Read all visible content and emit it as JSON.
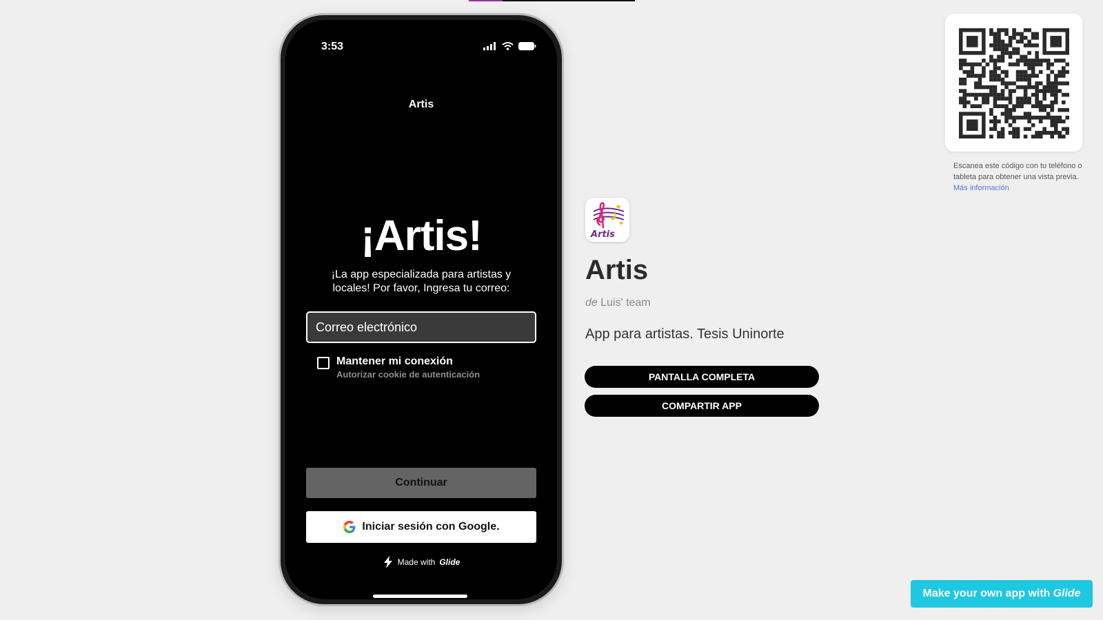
{
  "phone": {
    "status_time": "3:53",
    "app_title": "Artis",
    "hero": "¡Artis!",
    "subtitle": "¡La app especializada para artistas y locales! Por favor, Ingresa tu correo:",
    "email_placeholder": "Correo electrónico",
    "remember_label": "Mantener mi conexión",
    "remember_sub": "Autorizar cookie de autenticación",
    "continue_label": "Continuar",
    "google_label": "Iniciar sesión con Google.",
    "made_with_prefix": "Made with",
    "made_with_brand": "Glide"
  },
  "info": {
    "app_name": "Artis",
    "icon_text": "Artis",
    "by_prefix": "de",
    "by_team": "Luis' team",
    "description": "App para artistas. Tesis Uninorte",
    "fullscreen_label": "PANTALLA COMPLETA",
    "share_label": "COMPARTIR APP"
  },
  "qr": {
    "help_text": "Escanea este código con tu teléfono o tableta para obtener una vista previa.",
    "more_info_label": "Más información"
  },
  "cta": {
    "prefix": "Make your own app with",
    "brand": "Glide"
  },
  "colors": {
    "accent_cyan": "#1ec8e1",
    "link_blue": "#5a6fd6",
    "progress_purple": "#9c2aa0"
  }
}
